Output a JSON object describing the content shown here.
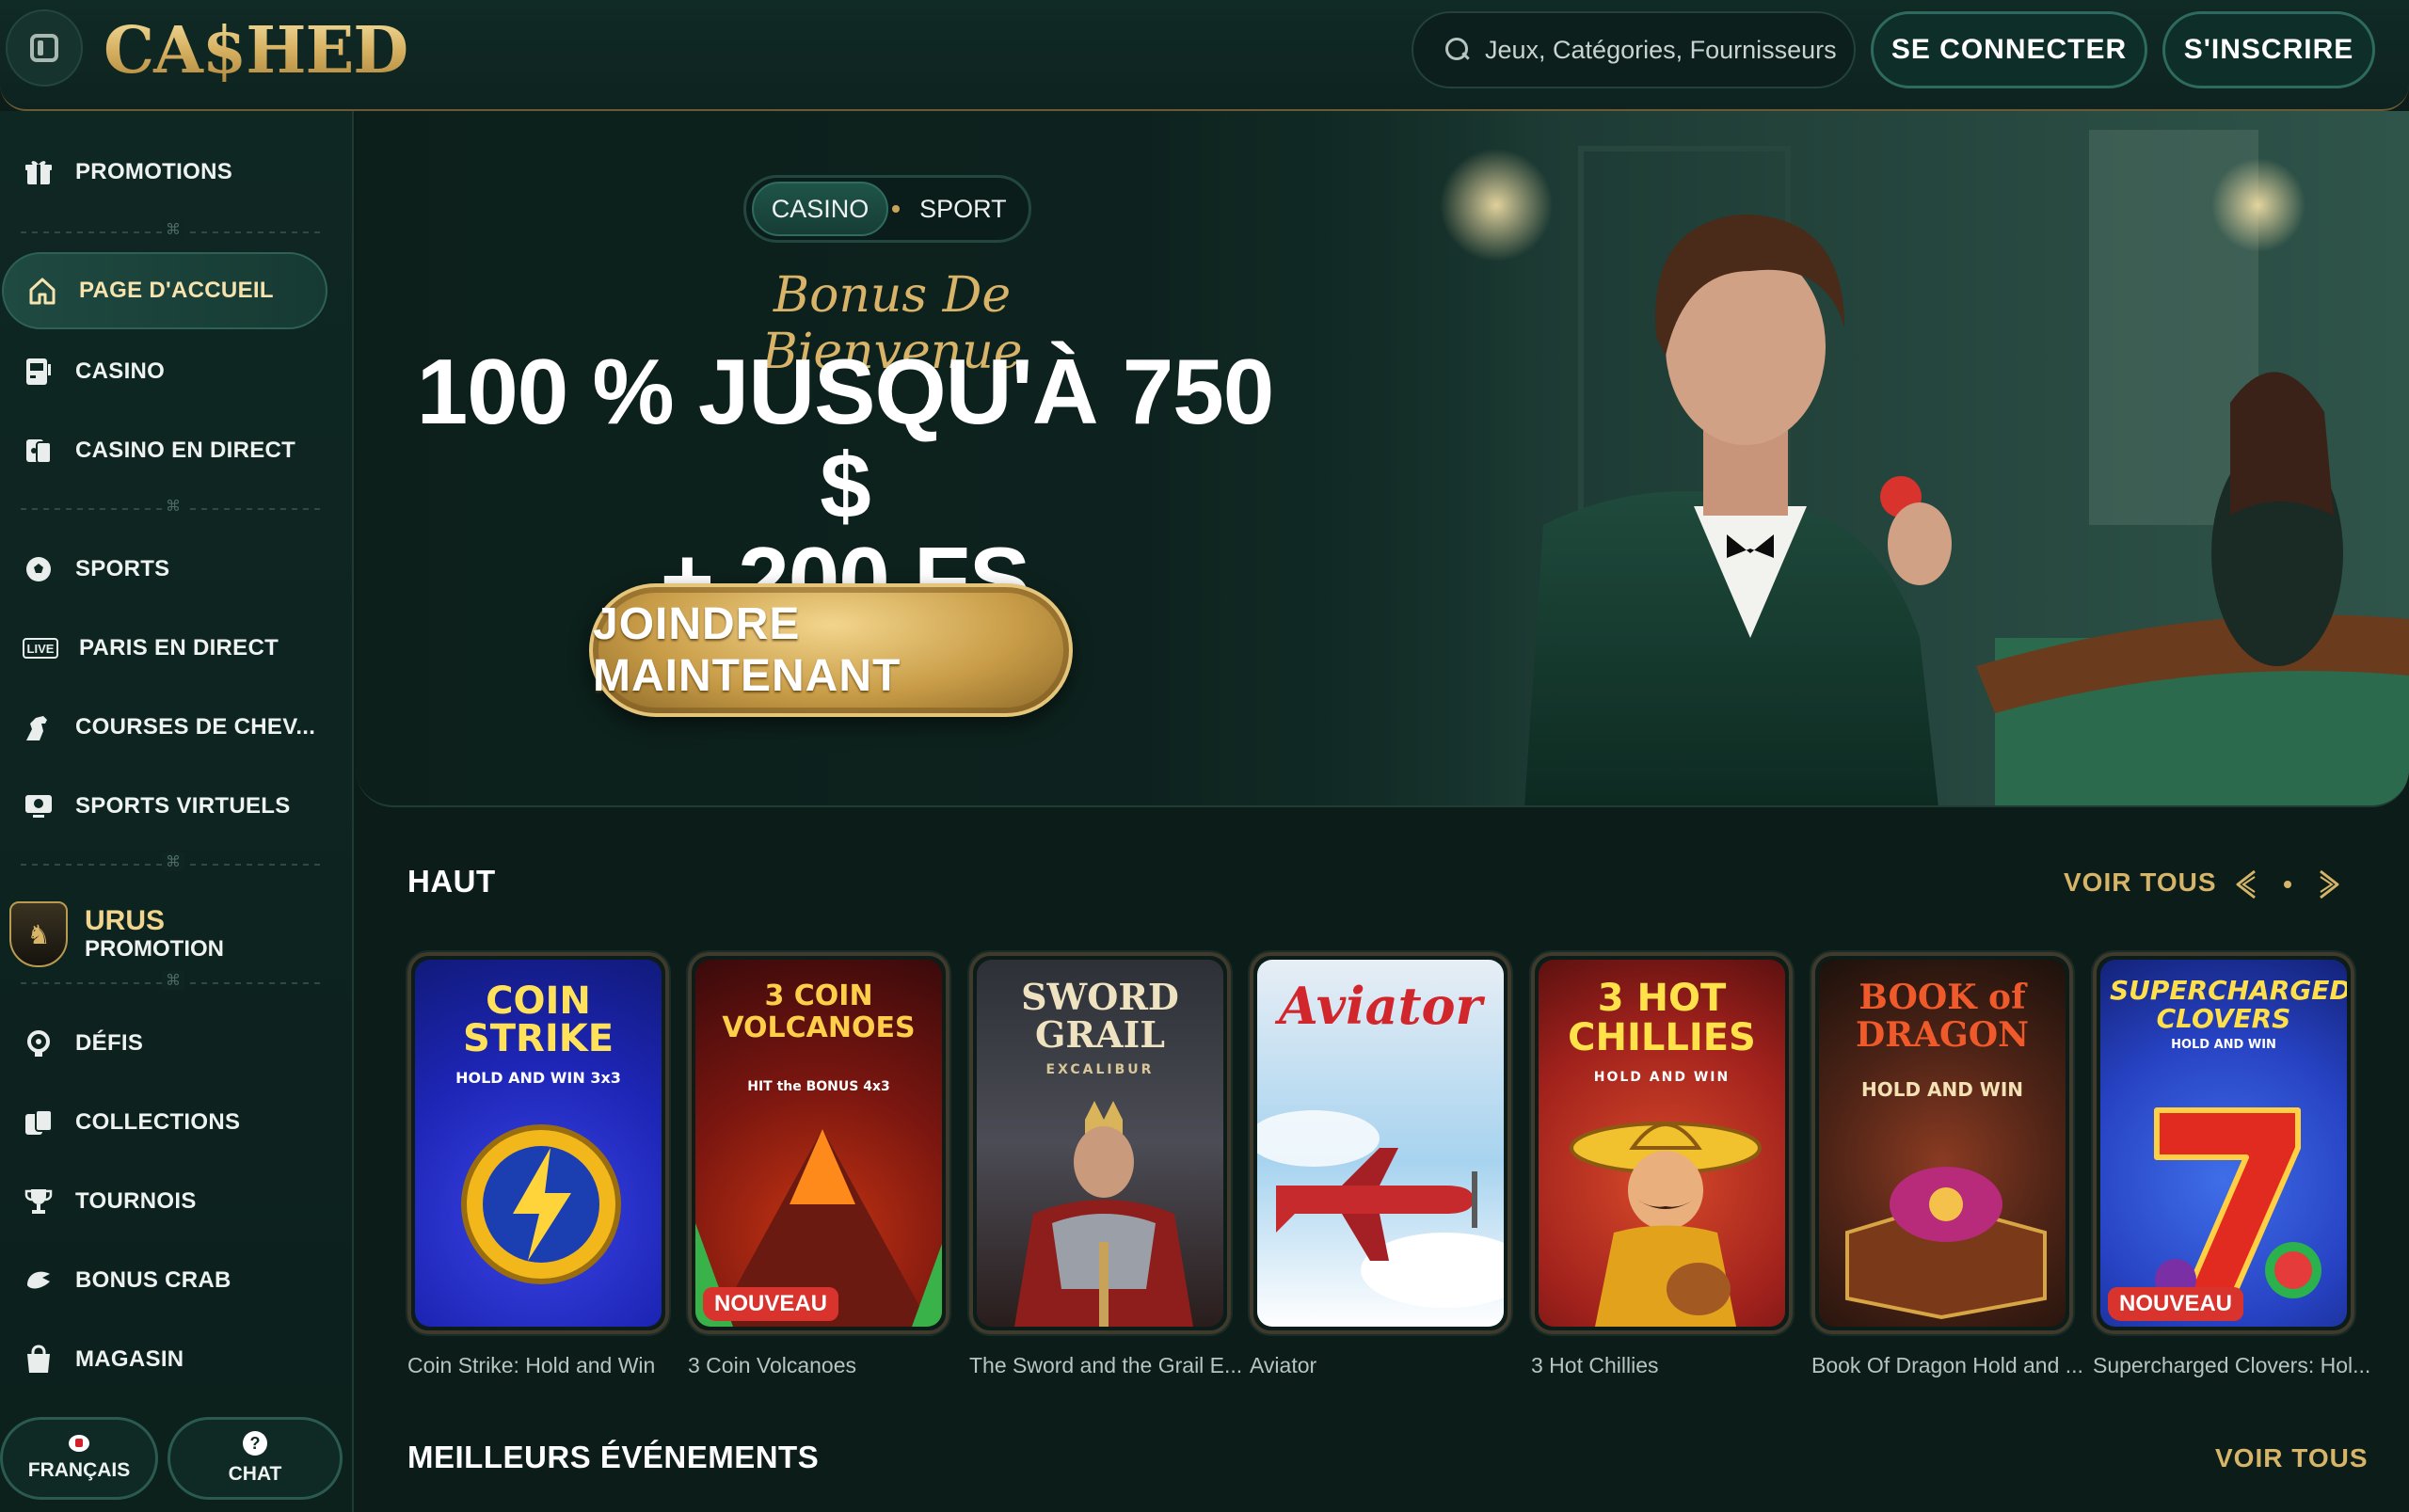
{
  "header": {
    "logo": "CA$HED",
    "search_placeholder": "Jeux, Catégories, Fournisseurs",
    "login_label": "SE CONNECTER",
    "signup_label": "S'INSCRIRE"
  },
  "sidebar": {
    "items": [
      {
        "label": "PROMOTIONS",
        "icon": "gift-icon"
      },
      {
        "label": "PAGE D'ACCUEIL",
        "icon": "home-icon",
        "active": true
      },
      {
        "label": "CASINO",
        "icon": "slot-machine-icon"
      },
      {
        "label": "CASINO EN DIRECT",
        "icon": "live-cards-icon"
      },
      {
        "label": "SPORTS",
        "icon": "soccer-ball-icon"
      },
      {
        "label": "PARIS EN DIRECT",
        "icon": "live-badge-icon"
      },
      {
        "label": "COURSES DE CHEV...",
        "icon": "horse-icon"
      },
      {
        "label": "SPORTS VIRTUELS",
        "icon": "virtual-screen-icon"
      },
      {
        "label": "DÉFIS",
        "icon": "challenge-gear-icon"
      },
      {
        "label": "COLLECTIONS",
        "icon": "cards-icon"
      },
      {
        "label": "TOURNOIS",
        "icon": "trophy-icon"
      },
      {
        "label": "BONUS CRAB",
        "icon": "crab-claw-icon"
      },
      {
        "label": "MAGASIN",
        "icon": "shopping-bag-icon"
      }
    ],
    "urus": {
      "title": "URUS",
      "subtitle": "PROMOTION"
    },
    "language_label": "FRANÇAIS",
    "chat_label": "CHAT"
  },
  "hero": {
    "tabs": [
      "CASINO",
      "SPORT"
    ],
    "active_tab": "CASINO",
    "script_title": "Bonus De Bienvenue",
    "line1": "100 % JUSQU'À 750 $",
    "line2": "+ 200 FS",
    "cta_label": "JOINDRE MAINTENANT"
  },
  "top_section": {
    "title": "HAUT",
    "see_all": "VOIR TOUS",
    "games": [
      {
        "name": "Coin Strike: Hold and Win",
        "art_title": "COIN STRIKE",
        "art_sub": "HOLD AND WIN 3x3",
        "new": false
      },
      {
        "name": "3 Coin Volcanoes",
        "art_title": "3 COIN VOLCANOES",
        "art_sub": "HIT the BONUS 4x3",
        "new": true
      },
      {
        "name": "The Sword and the Grail E...",
        "art_title": "SWORD GRAIL",
        "art_sub": "EXCALIBUR",
        "new": false
      },
      {
        "name": "Aviator",
        "art_title": "Aviator",
        "art_sub": "",
        "new": false
      },
      {
        "name": "3 Hot Chillies",
        "art_title": "3 HOT CHILLIES",
        "art_sub": "HOLD AND WIN",
        "new": false
      },
      {
        "name": "Book Of Dragon Hold and ...",
        "art_title": "BOOK of DRAGON",
        "art_sub": "HOLD AND WIN",
        "new": false
      },
      {
        "name": "Supercharged Clovers: Hol...",
        "art_title": "SUPERCHARGED CLOVERS",
        "art_sub": "HOLD AND WIN",
        "new": true
      }
    ],
    "new_badge": "NOUVEAU"
  },
  "events_section": {
    "title": "MEILLEURS ÉVÉNEMENTS",
    "see_all": "VOIR TOUS"
  },
  "colors": {
    "accent_gold": "#d6b468",
    "background": "#0b1c19",
    "panel": "#0f2723"
  }
}
